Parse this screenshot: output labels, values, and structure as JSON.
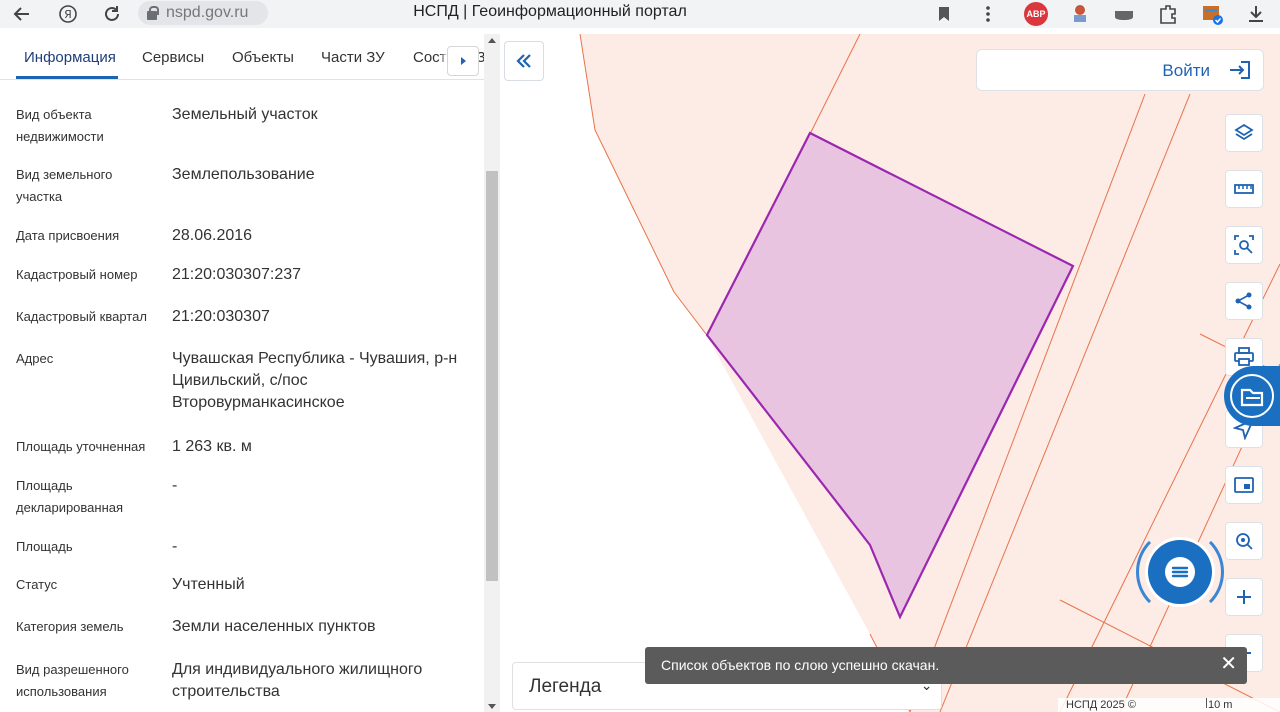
{
  "browser": {
    "url": "nspd.gov.ru",
    "tab_title": "НСПД | Геоинформационный портал",
    "abp_badge": "ABP"
  },
  "panel": {
    "tabs": [
      {
        "label": "Информация"
      },
      {
        "label": "Сервисы"
      },
      {
        "label": "Объекты"
      },
      {
        "label": "Части ЗУ"
      },
      {
        "label": "Состав ЕЗ"
      }
    ],
    "rows": [
      {
        "label": "Вид объекта недвижимости",
        "value": "Земельный участок"
      },
      {
        "label": "Вид земельного участка",
        "value": "Землепользование"
      },
      {
        "label": "Дата присвоения",
        "value": "28.06.2016"
      },
      {
        "label": "Кадастровый номер",
        "value": "21:20:030307:237"
      },
      {
        "label": "Кадастровый квартал",
        "value": "21:20:030307"
      },
      {
        "label": "Адрес",
        "value": "Чувашская Республика - Чувашия, р-н Цивильский, с/пос Второвурманкасинское"
      },
      {
        "label": "Площадь уточненная",
        "value": "1 263 кв. м"
      },
      {
        "label": "Площадь декларированная",
        "value": "-"
      },
      {
        "label": "Площадь",
        "value": "-"
      },
      {
        "label": "Статус",
        "value": "Учтенный"
      },
      {
        "label": "Категория земель",
        "value": "Земли населенных пунктов"
      },
      {
        "label": "Вид разрешенного использования",
        "value": "Для индивидуального жилищного строительства"
      }
    ]
  },
  "map": {
    "login_label": "Войти",
    "legend_label": "Легенда",
    "toast_text": "Список объектов по слою успешно скачан.",
    "attribution": "НСПД 2025 ©",
    "scale_label": "10 m",
    "parcel_fill": "#e8c4e0",
    "parcel_stroke": "#9b27b0",
    "background_fill": "#fdebe6",
    "boundary_color": "#e8734a"
  }
}
